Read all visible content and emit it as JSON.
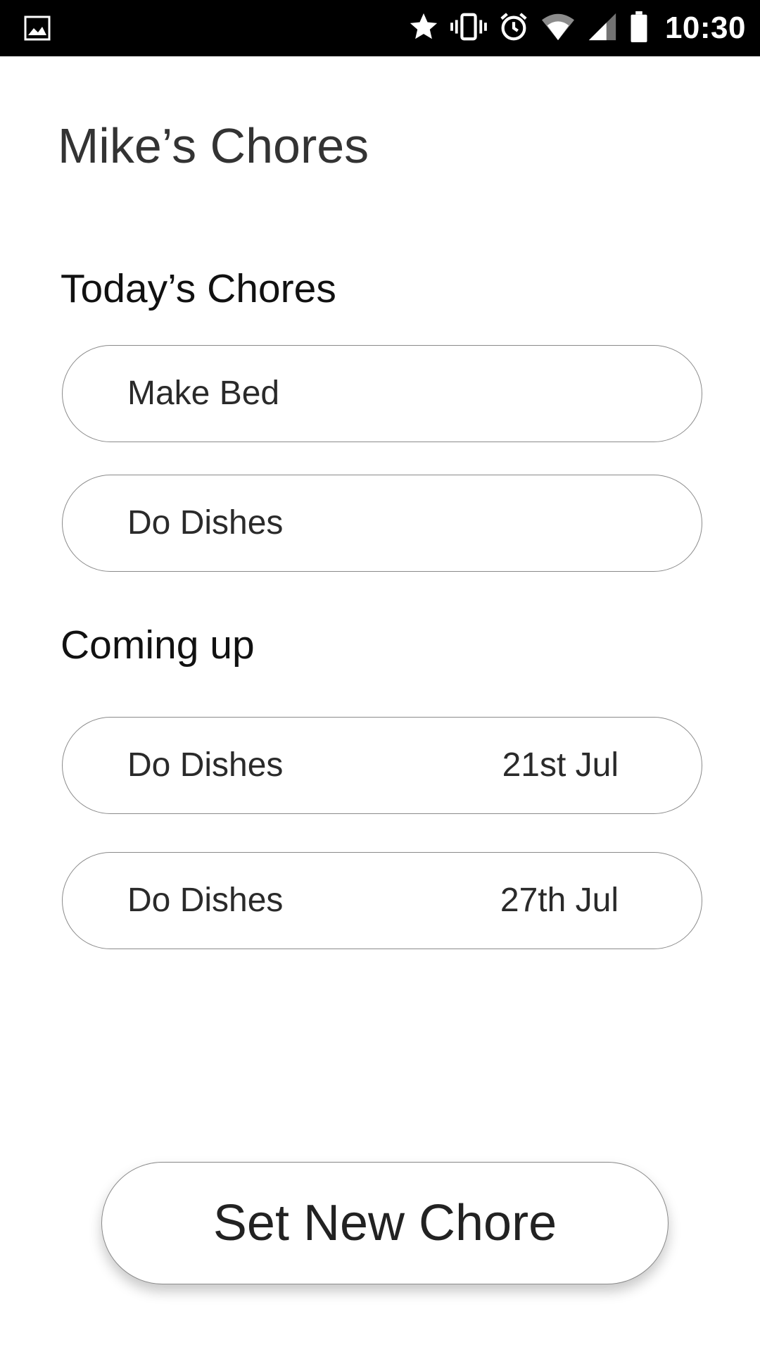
{
  "status_bar": {
    "time": "10:30",
    "icons": [
      "image-icon",
      "star-icon",
      "vibrate-icon",
      "alarm-icon",
      "wifi-icon",
      "cell-signal-icon",
      "battery-icon"
    ]
  },
  "app": {
    "title": "Mike’s Chores"
  },
  "today": {
    "heading": "Today’s Chores",
    "items": [
      {
        "name": "Make Bed"
      },
      {
        "name": "Do Dishes"
      }
    ]
  },
  "coming_up": {
    "heading": "Coming up",
    "items": [
      {
        "name": "Do Dishes",
        "date": "21st Jul"
      },
      {
        "name": "Do Dishes",
        "date": "27th Jul"
      }
    ]
  },
  "actions": {
    "set_new_chore_label": "Set New Chore"
  },
  "colors": {
    "background": "#ffffff",
    "status_bar": "#000000",
    "pill_border": "#8a8a8a",
    "text": "#111111"
  }
}
